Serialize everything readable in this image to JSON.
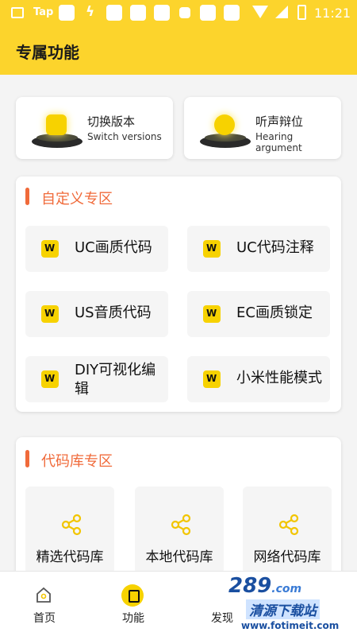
{
  "status_bar": {
    "carrier": "Tap",
    "time": "11:21"
  },
  "header": {
    "title": "专属功能"
  },
  "top_cards": [
    {
      "title": "切换版本",
      "subtitle": "Switch versions"
    },
    {
      "title": "听声辩位",
      "subtitle": "Hearing argument"
    }
  ],
  "custom_section": {
    "title": "自定义专区",
    "items": [
      {
        "label": "UC画质代码"
      },
      {
        "label": "UC代码注释"
      },
      {
        "label": "US音质代码"
      },
      {
        "label": "EC画质锁定"
      },
      {
        "label": "DIY可视化编辑"
      },
      {
        "label": "小米性能模式"
      }
    ]
  },
  "code_section": {
    "title": "代码库专区",
    "items": [
      {
        "label": "精选代码库"
      },
      {
        "label": "本地代码库"
      },
      {
        "label": "网络代码库"
      }
    ]
  },
  "bottom_nav": [
    {
      "label": "首页"
    },
    {
      "label": "功能"
    },
    {
      "label": "发现"
    }
  ],
  "watermark": {
    "number": "289",
    "suffix": ".com",
    "site": "清源下载站",
    "url": "www.fotimeit.com"
  },
  "colors": {
    "accent": "#fcd42c",
    "section_title": "#f06a3a",
    "icon_yellow": "#f7d200"
  }
}
